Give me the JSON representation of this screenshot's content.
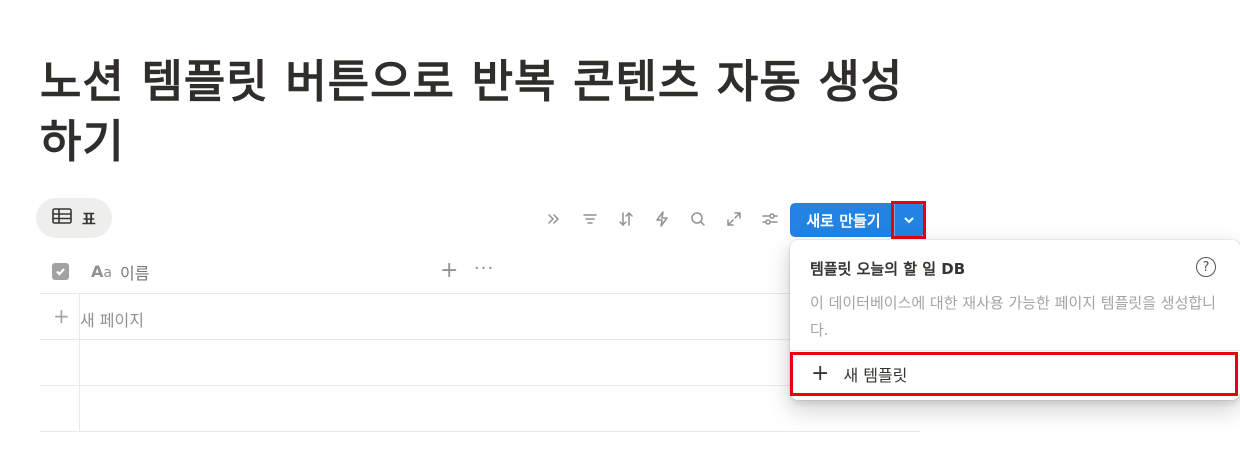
{
  "page": {
    "title": "노션 템플릿 버튼으로 반복 콘텐츠 자동 생성하기"
  },
  "view_tab": {
    "icon": "table-icon",
    "label": "표"
  },
  "toolbar": {
    "icons": [
      "double-chevron-icon",
      "filter-icon",
      "sort-icon",
      "lightning-icon",
      "search-icon",
      "expand-icon",
      "settings-sliders-icon"
    ],
    "new_button_label": "새로 만들기",
    "new_button_color": "#2383e2"
  },
  "table": {
    "columns": [
      {
        "icon": "text-aa-icon",
        "label": "이름"
      }
    ],
    "new_page_label": "새 페이지",
    "empty_rows": 2
  },
  "dropdown": {
    "title": "템플릿 오늘의 할 일 DB",
    "description": "이 데이터베이스에 대한 재사용 가능한 페이지 템플릿을 생성합니다.",
    "new_template_label": "새 템플릿",
    "help_symbol": "?"
  },
  "highlight_color": "#e8000b"
}
